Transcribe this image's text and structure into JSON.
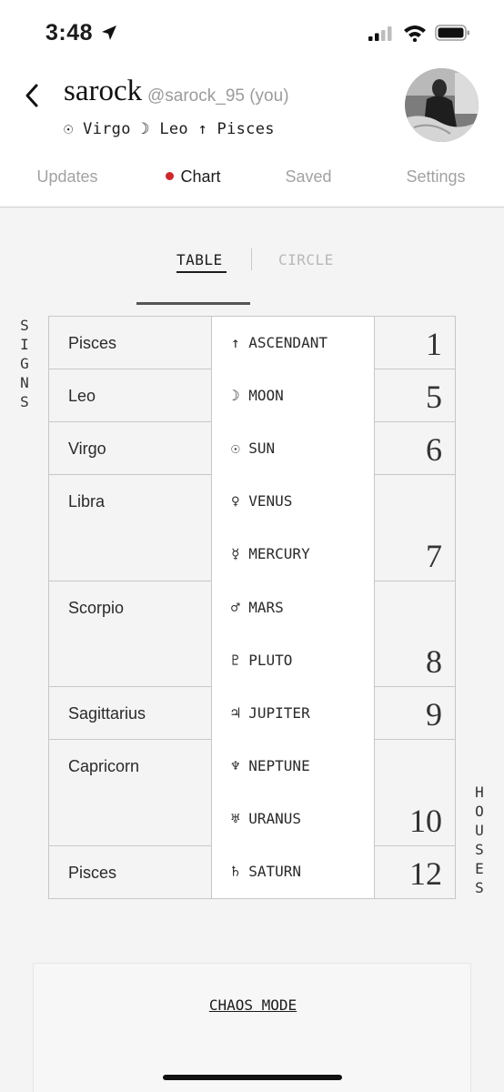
{
  "status_bar": {
    "time": "3:48"
  },
  "profile": {
    "username": "sarock",
    "handle": "@sarock_95 (you)",
    "placements": "☉ Virgo ☽ Leo ↑ Pisces"
  },
  "tabs": [
    {
      "label": "Updates",
      "active": false
    },
    {
      "label": "Chart",
      "active": true
    },
    {
      "label": "Saved",
      "active": false
    },
    {
      "label": "Settings",
      "active": false
    }
  ],
  "view_toggle": {
    "table": "TABLE",
    "circle": "CIRCLE",
    "selected": "TABLE"
  },
  "labels": {
    "signs": "SIGNS",
    "houses": "HOUSES"
  },
  "signs": [
    "Pisces",
    "Leo",
    "Virgo",
    "Libra",
    "Scorpio",
    "Sagittarius",
    "Capricorn",
    "Pisces"
  ],
  "planets": [
    "↑ ASCENDANT",
    "☽ MOON",
    "☉ SUN",
    "♀ VENUS",
    "☿ MERCURY",
    "♂ MARS",
    "♇ PLUTO",
    "♃ JUPITER",
    "♆ NEPTUNE",
    "♅ URANUS",
    "♄ SATURN"
  ],
  "houses": [
    "1",
    "5",
    "6",
    "7",
    "8",
    "9",
    "10",
    "12"
  ],
  "footer": {
    "chaos_mode": "CHAOS MODE"
  },
  "colors": {
    "accent_dot": "#d0262c",
    "muted": "#a2a2a2"
  }
}
